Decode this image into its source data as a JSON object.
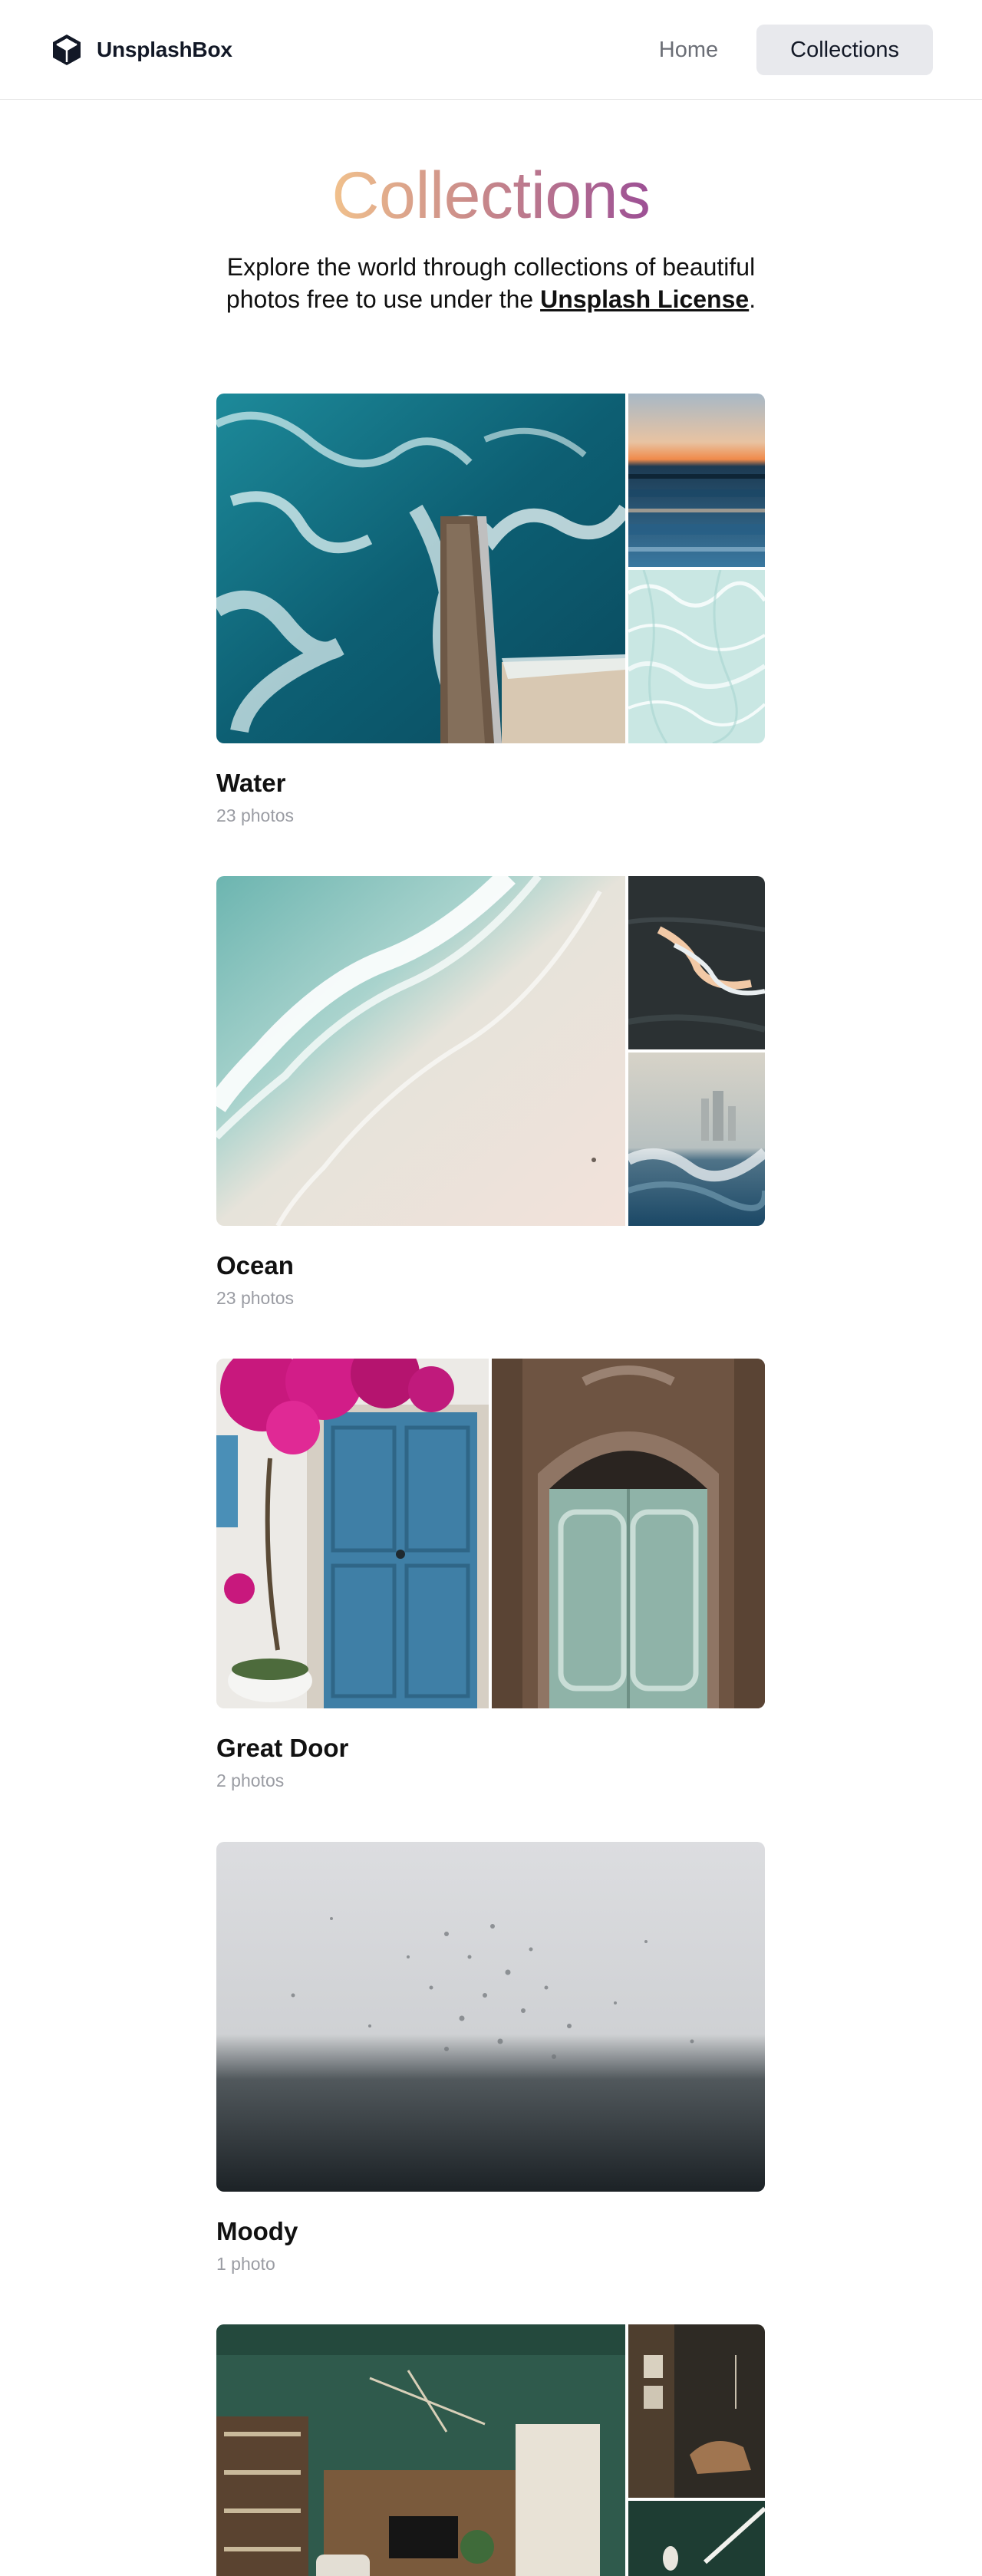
{
  "header": {
    "logo_text": "UnsplashBox",
    "nav": [
      {
        "label": "Home",
        "active": false
      },
      {
        "label": "Collections",
        "active": true
      }
    ]
  },
  "hero": {
    "title": "Collections",
    "subtitle_before": "Explore the world through collections of beautiful photos free to use under the ",
    "license_link": "Unsplash License",
    "subtitle_after": "."
  },
  "collections": [
    {
      "title": "Water",
      "count": "23 photos",
      "photos": [
        "aerial-sea-pier-photo",
        "sunset-sea-horizon-photo",
        "clear-water-ripples-photo"
      ]
    },
    {
      "title": "Ocean",
      "count": "23 photos",
      "photos": [
        "aerial-beach-wave-photo",
        "dark-wave-crest-photo",
        "city-ocean-spray-photo"
      ]
    },
    {
      "title": "Great Door",
      "count": "2 photos",
      "photos": [
        "blue-door-bougainvillea-photo",
        "ornate-green-door-photo"
      ]
    },
    {
      "title": "Moody",
      "count": "1 photo",
      "photos": [
        "rain-drops-window-photo"
      ]
    },
    {
      "title": "",
      "count": "",
      "photos": [
        "green-living-room-photo",
        "dark-interior-chair-photo",
        "green-wall-lamp-photo"
      ]
    }
  ],
  "colors": {
    "title_gradient": [
      "#f1c18c",
      "#c98a8a",
      "#9c4f95"
    ],
    "nav_active_bg": "#e8e9ed",
    "muted_text": "#9a9ca3"
  }
}
